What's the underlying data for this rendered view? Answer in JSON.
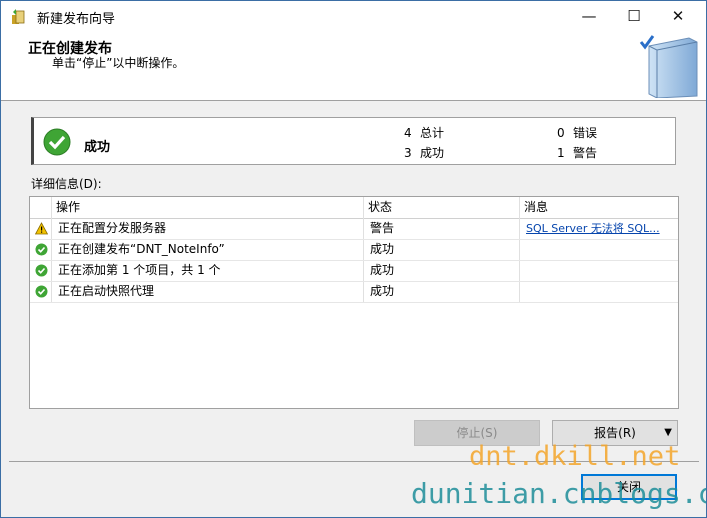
{
  "window": {
    "title": "新建发布向导",
    "controls": {
      "minimize": "—",
      "maximize": "☐",
      "close": "✕"
    }
  },
  "header": {
    "title": "正在创建发布",
    "subtitle": "单击“停止”以中断操作。",
    "graphic_icon": "book-check-icon"
  },
  "summary": {
    "status": "成功",
    "status_icon": "success-check-icon",
    "total_num": "4",
    "total_label": "总计",
    "success_num": "3",
    "success_label": "成功",
    "error_num": "0",
    "error_label": "错误",
    "warning_num": "1",
    "warning_label": "警告"
  },
  "details": {
    "label": "详细信息(D):",
    "columns": [
      "操作",
      "状态",
      "消息"
    ],
    "rows": [
      {
        "icon": "warning-icon",
        "action": "正在配置分发服务器",
        "status": "警告",
        "message": "SQL Server 无法将 SQL..."
      },
      {
        "icon": "success-icon",
        "action": "正在创建发布“DNT_NoteInfo”",
        "status": "成功",
        "message": ""
      },
      {
        "icon": "success-icon",
        "action": "正在添加第 1 个项目，共 1 个",
        "status": "成功",
        "message": ""
      },
      {
        "icon": "success-icon",
        "action": "正在启动快照代理",
        "status": "成功",
        "message": ""
      }
    ]
  },
  "buttons": {
    "stop": "停止(S)",
    "report": "报告(R)",
    "report_arrow": "▼",
    "close": "关闭"
  },
  "watermarks": {
    "line1": "dnt.dkill.net",
    "line2": "dunitian.cnblogs.com"
  },
  "colors": {
    "success": "#3fa535",
    "warning": "#f2c200",
    "link": "#0645ad",
    "focus": "#0078d7"
  }
}
